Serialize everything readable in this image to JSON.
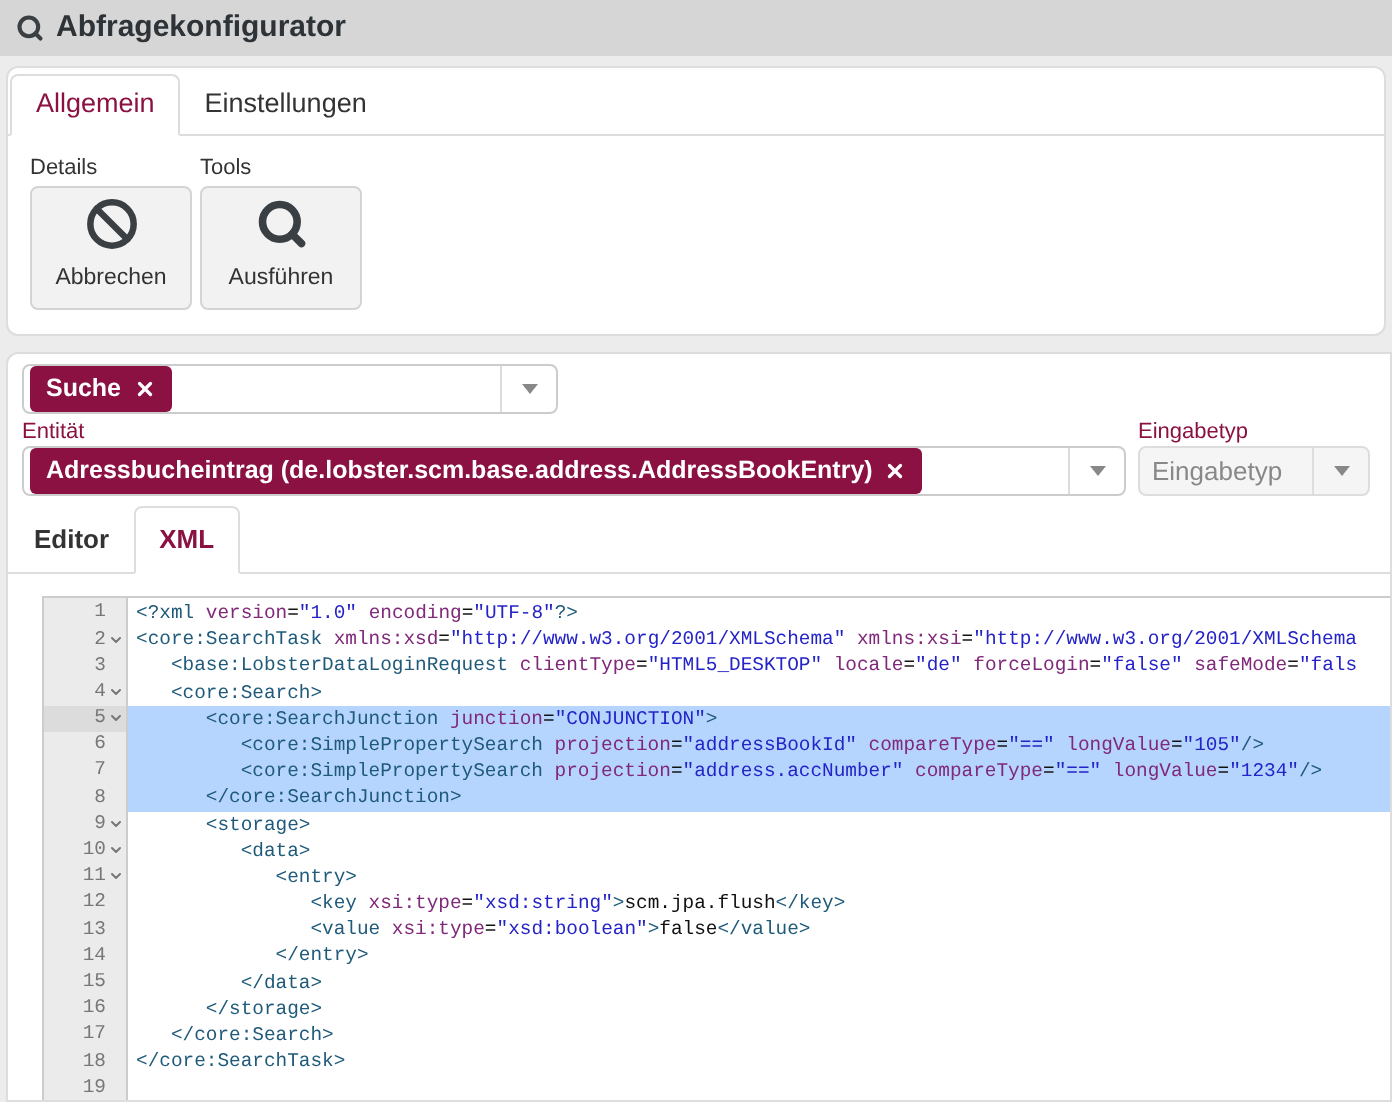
{
  "window": {
    "title": "Abfragekonfigurator"
  },
  "tabs": [
    {
      "label": "Allgemein",
      "selected": true
    },
    {
      "label": "Einstellungen",
      "selected": false
    }
  ],
  "toolbar_groups": [
    {
      "label": "Details",
      "buttons": [
        {
          "label": "Abbrechen",
          "kind": "cancel"
        }
      ]
    },
    {
      "label": "Tools",
      "buttons": [
        {
          "label": "Ausführen",
          "kind": "search"
        }
      ]
    }
  ],
  "query_select": {
    "tags": [
      "Suche"
    ]
  },
  "entity": {
    "label": "Entität",
    "tags": [
      "Adressbucheintrag (de.lobster.scm.base.address.AddressBookEntry)"
    ]
  },
  "input_type": {
    "label": "Eingabetyp",
    "placeholder": "Eingabetyp"
  },
  "editor_tabs": [
    {
      "label": "Editor",
      "selected": false
    },
    {
      "label": "XML",
      "selected": true
    }
  ],
  "code_lines": [
    {
      "number": "1",
      "foldable": false,
      "selected": false,
      "segments": [
        {
          "kind": "tag",
          "text": "<?xml"
        },
        {
          "kind": "attr",
          "text": " version"
        },
        {
          "kind": "text",
          "text": "="
        },
        {
          "kind": "value",
          "text": "\"1.0\""
        },
        {
          "kind": "attr",
          "text": " encoding"
        },
        {
          "kind": "text",
          "text": "="
        },
        {
          "kind": "value",
          "text": "\"UTF-8\""
        },
        {
          "kind": "tag",
          "text": "?>"
        }
      ]
    },
    {
      "number": "2",
      "foldable": true,
      "selected": false,
      "segments": [
        {
          "kind": "tag",
          "text": "<core:SearchTask"
        },
        {
          "kind": "attr",
          "text": " xmlns:xsd"
        },
        {
          "kind": "text",
          "text": "="
        },
        {
          "kind": "value",
          "text": "\"http://www.w3.org/2001/XMLSchema\""
        },
        {
          "kind": "attr",
          "text": " xmlns:xsi"
        },
        {
          "kind": "text",
          "text": "="
        },
        {
          "kind": "value",
          "text": "\"http://www.w3.org/2001/XMLSchema"
        }
      ]
    },
    {
      "number": "3",
      "foldable": false,
      "selected": false,
      "segments": [
        {
          "kind": "tag",
          "text": "   <base:LobsterDataLoginRequest"
        },
        {
          "kind": "attr",
          "text": " clientType"
        },
        {
          "kind": "text",
          "text": "="
        },
        {
          "kind": "value",
          "text": "\"HTML5_DESKTOP\""
        },
        {
          "kind": "attr",
          "text": " locale"
        },
        {
          "kind": "text",
          "text": "="
        },
        {
          "kind": "value",
          "text": "\"de\""
        },
        {
          "kind": "attr",
          "text": " forceLogin"
        },
        {
          "kind": "text",
          "text": "="
        },
        {
          "kind": "value",
          "text": "\"false\""
        },
        {
          "kind": "attr",
          "text": " safeMode"
        },
        {
          "kind": "text",
          "text": "="
        },
        {
          "kind": "value",
          "text": "\"fals"
        }
      ]
    },
    {
      "number": "4",
      "foldable": true,
      "selected": false,
      "segments": [
        {
          "kind": "tag",
          "text": "   <core:Search>"
        }
      ]
    },
    {
      "number": "5",
      "foldable": true,
      "selected": true,
      "segments": [
        {
          "kind": "tag",
          "text": "      <core:SearchJunction"
        },
        {
          "kind": "attr",
          "text": " junction"
        },
        {
          "kind": "text",
          "text": "="
        },
        {
          "kind": "value",
          "text": "\"CONJUNCTION\""
        },
        {
          "kind": "tag",
          "text": ">"
        }
      ]
    },
    {
      "number": "6",
      "foldable": false,
      "selected": true,
      "segments": [
        {
          "kind": "tag",
          "text": "         <core:SimplePropertySearch"
        },
        {
          "kind": "attr",
          "text": " projection"
        },
        {
          "kind": "text",
          "text": "="
        },
        {
          "kind": "value",
          "text": "\"addressBookId\""
        },
        {
          "kind": "attr",
          "text": " compareType"
        },
        {
          "kind": "text",
          "text": "="
        },
        {
          "kind": "value",
          "text": "\"==\""
        },
        {
          "kind": "attr",
          "text": " longValue"
        },
        {
          "kind": "text",
          "text": "="
        },
        {
          "kind": "value",
          "text": "\"105\""
        },
        {
          "kind": "tag",
          "text": "/>"
        }
      ]
    },
    {
      "number": "7",
      "foldable": false,
      "selected": true,
      "segments": [
        {
          "kind": "tag",
          "text": "         <core:SimplePropertySearch"
        },
        {
          "kind": "attr",
          "text": " projection"
        },
        {
          "kind": "text",
          "text": "="
        },
        {
          "kind": "value",
          "text": "\"address.accNumber\""
        },
        {
          "kind": "attr",
          "text": " compareType"
        },
        {
          "kind": "text",
          "text": "="
        },
        {
          "kind": "value",
          "text": "\"==\""
        },
        {
          "kind": "attr",
          "text": " longValue"
        },
        {
          "kind": "text",
          "text": "="
        },
        {
          "kind": "value",
          "text": "\"1234\""
        },
        {
          "kind": "tag",
          "text": "/>"
        }
      ]
    },
    {
      "number": "8",
      "foldable": false,
      "selected": true,
      "segments": [
        {
          "kind": "tag",
          "text": "      </core:SearchJunction>"
        }
      ]
    },
    {
      "number": "9",
      "foldable": true,
      "selected": false,
      "segments": [
        {
          "kind": "tag",
          "text": "      <storage>"
        }
      ]
    },
    {
      "number": "10",
      "foldable": true,
      "selected": false,
      "segments": [
        {
          "kind": "tag",
          "text": "         <data>"
        }
      ]
    },
    {
      "number": "11",
      "foldable": true,
      "selected": false,
      "segments": [
        {
          "kind": "tag",
          "text": "            <entry>"
        }
      ]
    },
    {
      "number": "12",
      "foldable": false,
      "selected": false,
      "segments": [
        {
          "kind": "tag",
          "text": "               <key"
        },
        {
          "kind": "attr",
          "text": " xsi:type"
        },
        {
          "kind": "text",
          "text": "="
        },
        {
          "kind": "value",
          "text": "\"xsd:string\""
        },
        {
          "kind": "tag",
          "text": ">"
        },
        {
          "kind": "text",
          "text": "scm.jpa.flush"
        },
        {
          "kind": "tag",
          "text": "</key>"
        }
      ]
    },
    {
      "number": "13",
      "foldable": false,
      "selected": false,
      "segments": [
        {
          "kind": "tag",
          "text": "               <value"
        },
        {
          "kind": "attr",
          "text": " xsi:type"
        },
        {
          "kind": "text",
          "text": "="
        },
        {
          "kind": "value",
          "text": "\"xsd:boolean\""
        },
        {
          "kind": "tag",
          "text": ">"
        },
        {
          "kind": "text",
          "text": "false"
        },
        {
          "kind": "tag",
          "text": "</value>"
        }
      ]
    },
    {
      "number": "14",
      "foldable": false,
      "selected": false,
      "segments": [
        {
          "kind": "tag",
          "text": "            </entry>"
        }
      ]
    },
    {
      "number": "15",
      "foldable": false,
      "selected": false,
      "segments": [
        {
          "kind": "tag",
          "text": "         </data>"
        }
      ]
    },
    {
      "number": "16",
      "foldable": false,
      "selected": false,
      "segments": [
        {
          "kind": "tag",
          "text": "      </storage>"
        }
      ]
    },
    {
      "number": "17",
      "foldable": false,
      "selected": false,
      "segments": [
        {
          "kind": "tag",
          "text": "   </core:Search>"
        }
      ]
    },
    {
      "number": "18",
      "foldable": false,
      "selected": false,
      "segments": [
        {
          "kind": "tag",
          "text": "</core:SearchTask>"
        }
      ]
    },
    {
      "number": "19",
      "foldable": false,
      "selected": false
    }
  ]
}
